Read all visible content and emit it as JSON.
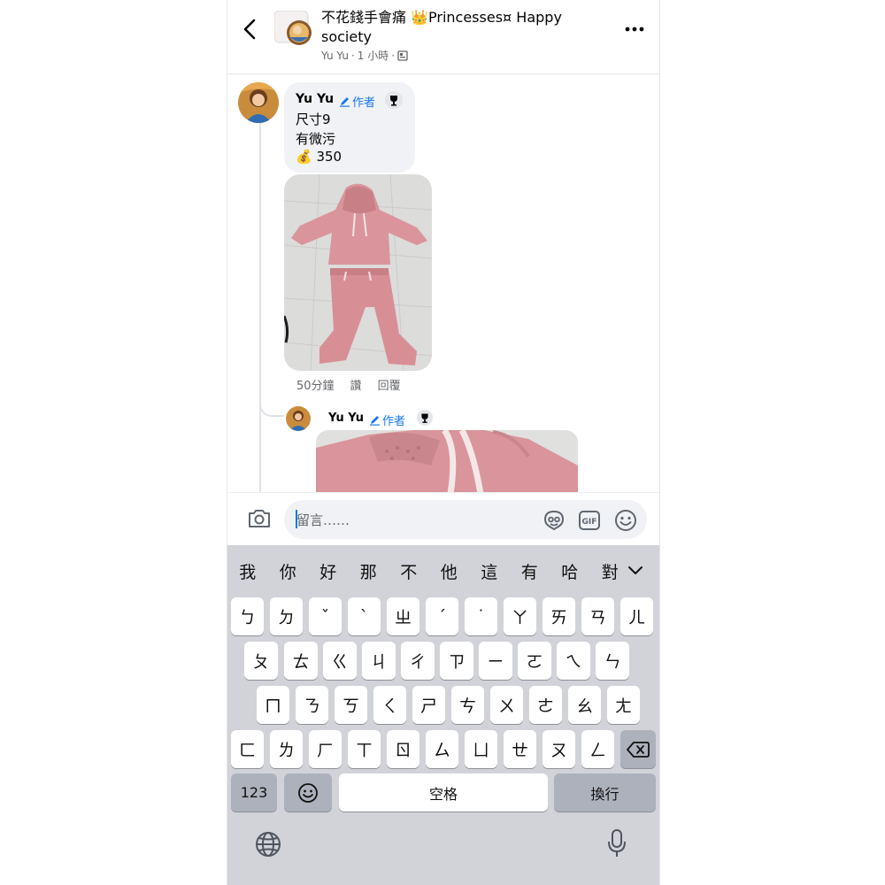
{
  "header": {
    "group_name": "不花錢手會痛 👑Princesses¤ Happy society",
    "poster": "Yu Yu",
    "time": "1 小時",
    "separator": "·"
  },
  "comment": {
    "author": "Yu Yu",
    "badge": "作者",
    "lines": [
      "尺寸9",
      "有微污",
      "💰 350"
    ],
    "time": "50分鐘",
    "like": "讚",
    "reply": "回覆"
  },
  "reply": {
    "author": "Yu Yu",
    "badge": "作者"
  },
  "input": {
    "placeholder": "留言……"
  },
  "keyboard": {
    "candidates": [
      "我",
      "你",
      "好",
      "那",
      "不",
      "他",
      "這",
      "有",
      "哈",
      "對"
    ],
    "row1": [
      "ㄅ",
      "ㄉ",
      "ˇ",
      "ˋ",
      "ㄓ",
      "ˊ",
      "˙",
      "ㄚ",
      "ㄞ",
      "ㄢ",
      "ㄦ"
    ],
    "row2": [
      "ㄆ",
      "ㄊ",
      "ㄍ",
      "ㄐ",
      "ㄔ",
      "ㄗ",
      "ㄧ",
      "ㄛ",
      "ㄟ",
      "ㄣ"
    ],
    "row3": [
      "ㄇ",
      "ㄋ",
      "ㄎ",
      "ㄑ",
      "ㄕ",
      "ㄘ",
      "ㄨ",
      "ㄜ",
      "ㄠ",
      "ㄤ"
    ],
    "row4": [
      "ㄈ",
      "ㄌ",
      "ㄏ",
      "ㄒ",
      "ㄖ",
      "ㄙ",
      "ㄩ",
      "ㄝ",
      "ㄡ",
      "ㄥ"
    ],
    "numbers_label": "123",
    "space_label": "空格",
    "return_label": "換行"
  },
  "icons": [
    "back-icon",
    "more-icon",
    "privacy-icon",
    "pencil-icon",
    "trophy-icon",
    "camera-icon",
    "sticker-icon",
    "gif-icon",
    "emoji-icon",
    "chevron-down-icon",
    "delete-icon",
    "globe-icon",
    "mic-icon"
  ],
  "colors": {
    "link_blue": "#1877f2",
    "secondary_text": "#65676b",
    "bubble_bg": "#f0f2f5",
    "keyboard_bg": "#d1d3d9",
    "garment_pink": "#d9959b"
  }
}
